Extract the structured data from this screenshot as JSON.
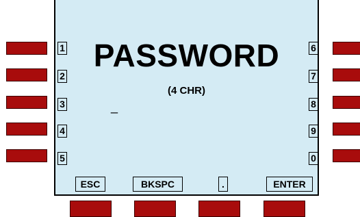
{
  "screen": {
    "title": "PASSWORD",
    "subtitle": "(4 CHR)",
    "entry_cursor": "_"
  },
  "left_labels": [
    "1",
    "2",
    "3",
    "4",
    "5"
  ],
  "right_labels": [
    "6",
    "7",
    "8",
    "9",
    "0"
  ],
  "bottom_labels": {
    "esc": "ESC",
    "bkspc": "BKSPC",
    "dot": ".",
    "enter": "ENTER"
  },
  "colors": {
    "screen_bg": "#d4ebf4",
    "softkey": "#a80c0c"
  }
}
